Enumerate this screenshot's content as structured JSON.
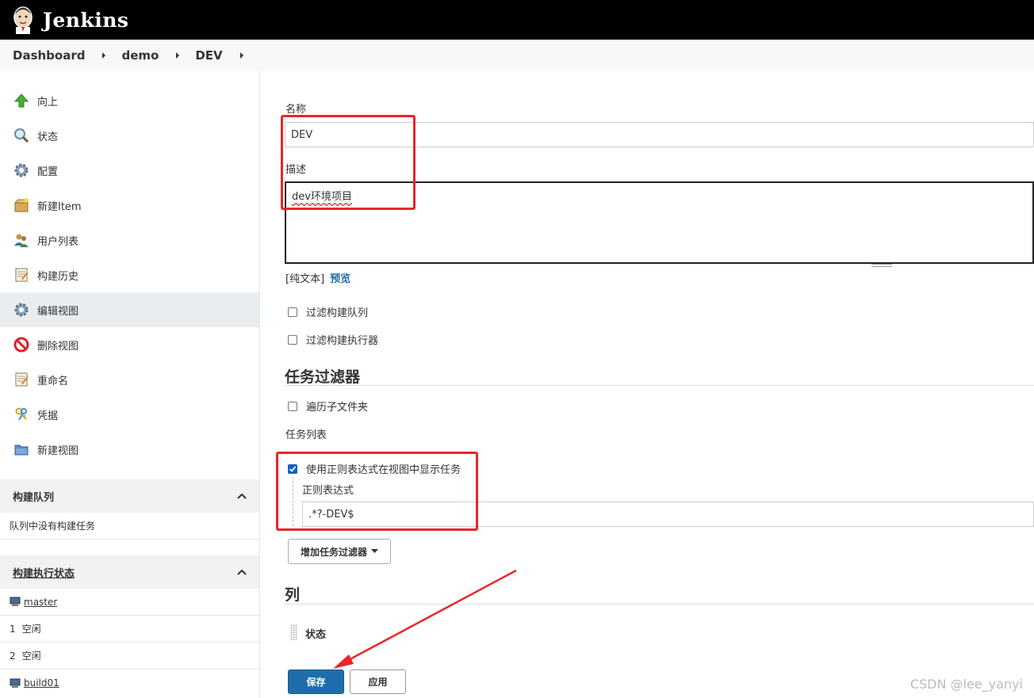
{
  "header": {
    "brand": "Jenkins"
  },
  "breadcrumb": [
    "Dashboard",
    "demo",
    "DEV"
  ],
  "sidebar": {
    "tasks": [
      {
        "label": "向上",
        "icon": "up-arrow-icon"
      },
      {
        "label": "状态",
        "icon": "search-icon"
      },
      {
        "label": "配置",
        "icon": "gear-icon"
      },
      {
        "label": "新建Item",
        "icon": "new-package-icon"
      },
      {
        "label": "用户列表",
        "icon": "users-icon"
      },
      {
        "label": "构建历史",
        "icon": "notepad-icon"
      },
      {
        "label": "编辑视图",
        "icon": "gear-icon"
      },
      {
        "label": "删除视图",
        "icon": "no-entry-icon"
      },
      {
        "label": "重命名",
        "icon": "notepad-icon"
      },
      {
        "label": "凭据",
        "icon": "keys-icon"
      },
      {
        "label": "新建视图",
        "icon": "folder-icon"
      }
    ],
    "active_index": 6,
    "build_queue": {
      "title": "构建队列",
      "empty_text": "队列中没有构建任务"
    },
    "executors": {
      "title": "构建执行状态",
      "rows": [
        {
          "kind": "node",
          "text": "master"
        },
        {
          "kind": "slot",
          "num": "1",
          "text": "空闲"
        },
        {
          "kind": "slot",
          "num": "2",
          "text": "空闲"
        },
        {
          "kind": "node",
          "text": "build01"
        }
      ]
    }
  },
  "form": {
    "name_label": "名称",
    "name_value": "DEV",
    "desc_label": "描述",
    "desc_value": "dev环境项目",
    "plain_text": "[纯文本]",
    "preview": "预览",
    "filter_queue": "过滤构建队列",
    "filter_executors": "过滤构建执行器",
    "job_filters_title": "任务过滤器",
    "recurse": "遍历子文件夹",
    "job_list_label": "任务列表",
    "use_regex": "使用正则表达式在视图中显示任务",
    "regex_label": "正则表达式",
    "regex_value": ".*?-DEV$",
    "add_filter": "增加任务过滤器",
    "columns_title": "列",
    "column_status": "状态",
    "save": "保存",
    "apply": "应用"
  },
  "colors": {
    "accent": "#1f6daa",
    "annotation": "#e8262b"
  },
  "watermark": "CSDN @lee_yanyi"
}
